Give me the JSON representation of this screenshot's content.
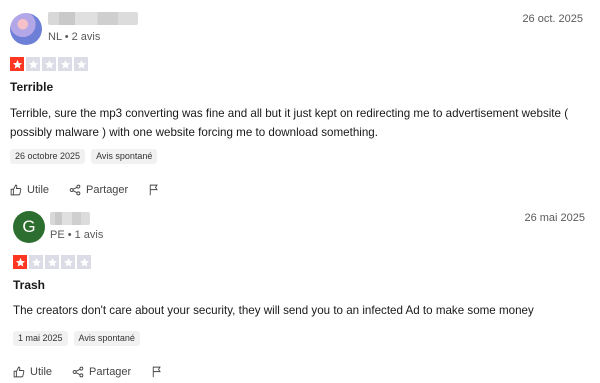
{
  "reviews": [
    {
      "avatar": "user-photo",
      "meta": "NL • 2 avis",
      "date": "26 oct. 2025",
      "rating": 1,
      "rating_max": 5,
      "title": "Terrible",
      "body": "Terrible, sure the mp3 converting was fine and all but it just kept on redirecting me to advertisement website ( possibly malware ) with one website forcing me to download something.",
      "tags": [
        "26 octobre 2025",
        "Avis spontané"
      ],
      "actions": {
        "useful": "Utile",
        "share": "Partager"
      }
    },
    {
      "avatar_letter": "G",
      "meta": "PE • 1 avis",
      "date": "26 mai 2025",
      "rating": 1,
      "rating_max": 5,
      "title": "Trash",
      "body": "The creators don't care about your security, they will send you to an infected Ad to make some money",
      "tags": [
        "1 mai 2025",
        "Avis spontané"
      ],
      "actions": {
        "useful": "Utile",
        "share": "Partager"
      }
    }
  ],
  "colors": {
    "star_on": "#ff3722",
    "star_off": "#dcdce6",
    "avatar_green": "#2c6e2f"
  },
  "icons": [
    "thumbs-up-icon",
    "share-icon",
    "flag-icon",
    "star-icon"
  ]
}
